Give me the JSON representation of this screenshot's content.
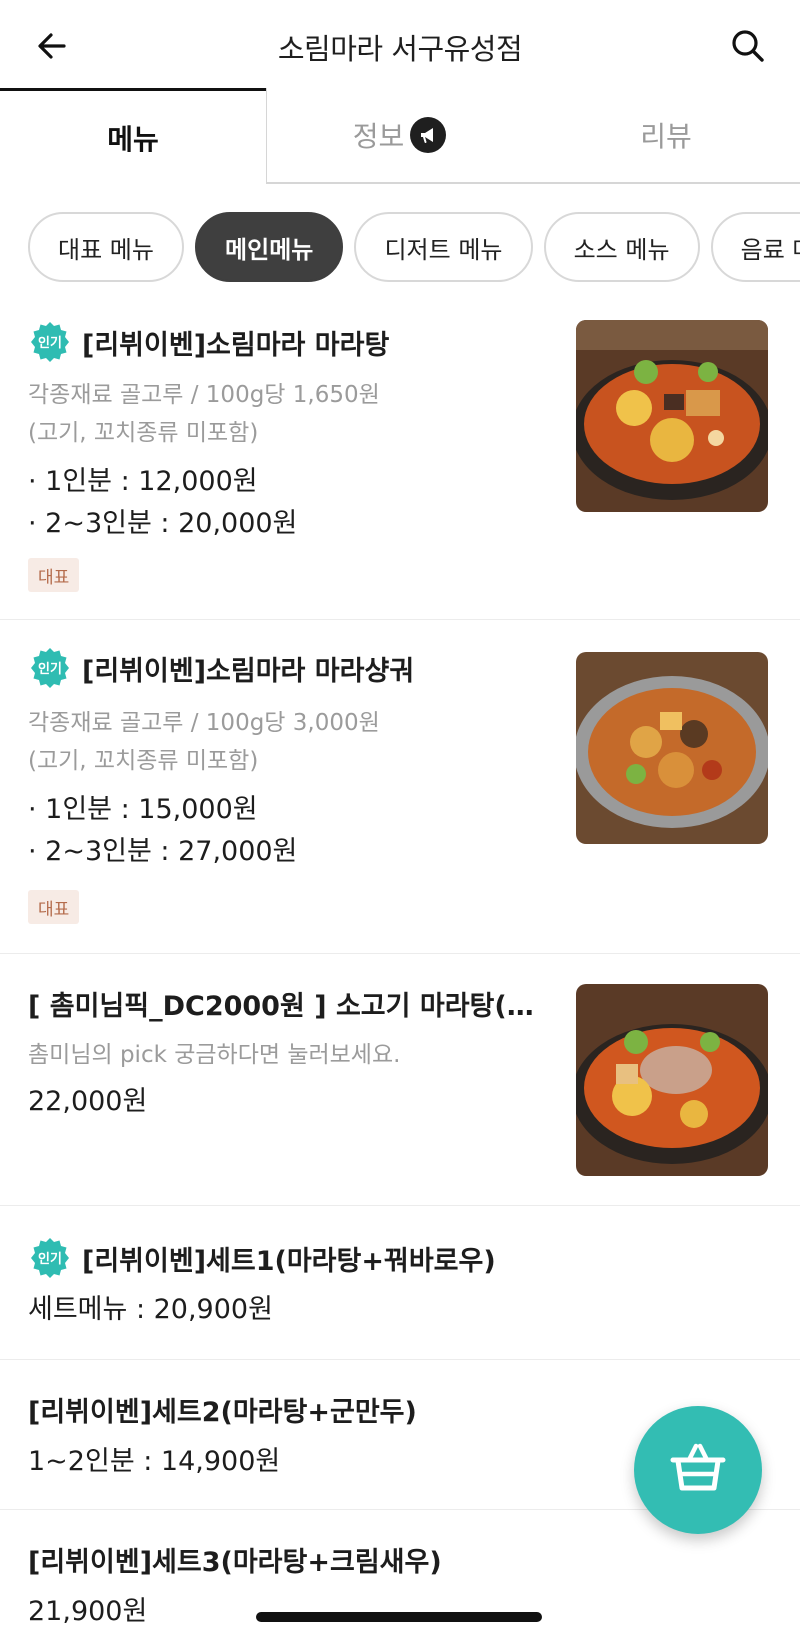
{
  "header": {
    "title": "소림마라 서구유성점",
    "back_icon": "arrow-left-icon",
    "search_icon": "search-icon"
  },
  "tabs": [
    {
      "label": "메뉴",
      "active": true
    },
    {
      "label": "정보",
      "icon": "megaphone-icon"
    },
    {
      "label": "리뷰"
    }
  ],
  "categories": [
    {
      "label": "대표 메뉴"
    },
    {
      "label": "메인메뉴",
      "active": true
    },
    {
      "label": "디저트 메뉴"
    },
    {
      "label": "소스 메뉴"
    },
    {
      "label": "음료 메뉴"
    }
  ],
  "popular_badge": "인기",
  "representative_tag": "대표",
  "items": [
    {
      "title": "[리뷔이벤]소림마라 마라탕",
      "popular": true,
      "desc": [
        "각종재료 골고루 / 100g당 1,650원",
        "(고기, 꼬치종류 미포함)"
      ],
      "prices": [
        "· 1인분 : 12,000원",
        "· 2~3인분 : 20,000원"
      ],
      "tag": "대표",
      "image": "malatang-photo"
    },
    {
      "title": "[리뷔이벤]소림마라 마라샹궈",
      "popular": true,
      "desc": [
        "각종재료 골고루 / 100g당 3,000원",
        "(고기, 꼬치종류 미포함)"
      ],
      "prices": [
        "· 1인분 : 15,000원",
        "· 2~3인분 : 27,000원"
      ],
      "tag": "대표",
      "image": "malaxiangguo-photo"
    },
    {
      "title": "[ 촘미님픽_DC2000원 ] 소고기 마라탕(…",
      "popular": false,
      "desc": [
        "촘미님의 pick 궁금하다면 눌러보세요."
      ],
      "prices": [
        "22,000원"
      ],
      "image": "beef-malatang-photo"
    },
    {
      "title": "[리뷔이벤]세트1(마라탕+꿔바로우)",
      "popular": true,
      "prices": [
        "세트메뉴 : 20,900원"
      ]
    },
    {
      "title": "[리뷔이벤]세트2(마라탕+군만두)",
      "popular": false,
      "prices": [
        "1~2인분 : 14,900원"
      ]
    },
    {
      "title": "[리뷔이벤]세트3(마라탕+크림새우)",
      "popular": false,
      "prices": [
        "21,900원"
      ]
    }
  ],
  "fab": {
    "icon": "basket-icon"
  },
  "colors": {
    "accent": "#33bdb3",
    "chip_active": "#3f3f3f",
    "tag_bg": "#f7ebe5",
    "tag_text": "#b46b4b"
  }
}
